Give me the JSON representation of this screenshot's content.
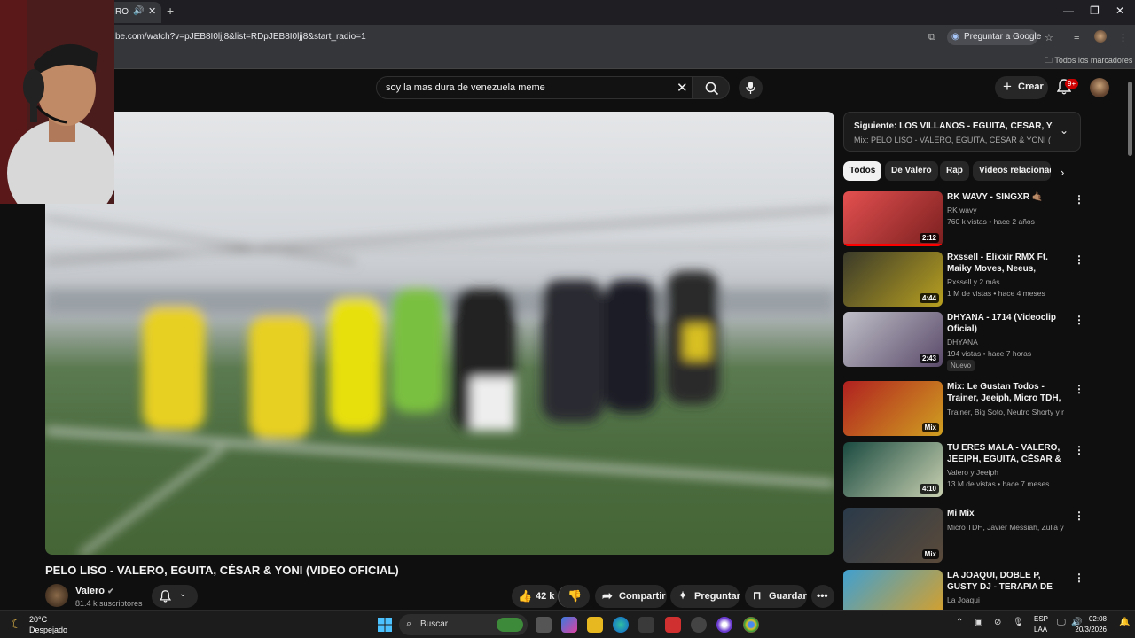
{
  "browser": {
    "tab_title": "RO",
    "url": "be.com/watch?v=pJEB8I0ljj8&list=RDpJEB8I0ljj8&start_radio=1",
    "ask_google": "Preguntar a Google",
    "all_bookmarks": "Todos los marcadores"
  },
  "youtube": {
    "search_query": "soy la mas dura de venezuela meme",
    "create_label": "Crear",
    "notification_count": "9+"
  },
  "video": {
    "title": "PELO LISO - VALERO, EGUITA, CÉSAR & YONI (VIDEO OFICIAL)",
    "channel": "Valero",
    "subscribers": "81.4 k suscriptores",
    "likes": "42 k",
    "share_label": "Compartir",
    "ask_label": "Preguntar",
    "save_label": "Guardar"
  },
  "up_next": {
    "title": "Siguiente: LOS VILLANOS - EGUITA, CESAR, YONI, V...",
    "subtitle": "Mix: PELO LISO - VALERO, EGUITA, CÉSAR & YONI (VIDEO OFIC"
  },
  "chips": [
    "Todos",
    "De Valero",
    "Rap",
    "Videos relacionados"
  ],
  "recommendations": [
    {
      "title": "RK WAVY - SINGXR 🤙🏽",
      "channel": "RK wavy",
      "meta": "760 k vistas • hace 2 años",
      "duration": "2:12",
      "progress": 1.0,
      "color1": "#e45050",
      "color2": "#7a1f1f"
    },
    {
      "title": "Rxssell - Elixxir RMX Ft. Maiky Moves, Neeus, SOYNEEL (Vide...",
      "channel": "Rxssell",
      "channel_extra": "y 2 más",
      "meta": "1 M de vistas • hace 4 meses",
      "duration": "4:44",
      "progress": 0.0,
      "color1": "#3a3a2a",
      "color2": "#b8a020"
    },
    {
      "title": "DHYANA - 1714 (Videoclip Oficial)",
      "channel": "DHYANA",
      "meta": "194 vistas • hace 7 horas",
      "badge": "Nuevo",
      "duration": "2:43",
      "progress": 0.0,
      "color1": "#c0c0c8",
      "color2": "#5a4a6a"
    },
    {
      "title": "Mix: Le Gustan Todos - Trainer, Jeeiph, Micro TDH, Big Soto, ...",
      "channel": "Trainer, Big Soto, Neutro Shorty y mucho...",
      "duration": "Mix",
      "progress": 0.0,
      "color1": "#b02020",
      "color2": "#d0a020"
    },
    {
      "title": "TU ERES MALA - VALERO, JEEIPH, EGUITA, CÉSAR & YO...",
      "channel": "Valero",
      "channel_extra": "y Jeeiph",
      "meta": "13 M de vistas • hace 7 meses",
      "duration": "4:10",
      "progress": 0.0,
      "color1": "#1a4a40",
      "color2": "#c8d0b0"
    },
    {
      "title": "Mi Mix",
      "channel": "Micro TDH, Javier Messiah, Zulla y much...",
      "duration": "Mix",
      "progress": 0.0,
      "color1": "#2a3a4a",
      "color2": "#5a4a3a"
    },
    {
      "title": "LA JOAQUI, DOBLE P, GUSTY DJ - TERAPIA DE CHOQUE (Video...",
      "channel": "La Joaqui",
      "duration": "",
      "progress": 0.0,
      "color1": "#40a0d0",
      "color2": "#e0a020"
    }
  ],
  "taskbar": {
    "temperature": "20°C",
    "weather": "Despejado",
    "search_placeholder": "Buscar",
    "lang1": "ESP",
    "lang2": "LAA",
    "time": "02:08",
    "date": "20/3/2026"
  },
  "colors": {
    "accent_red": "#ff0000",
    "badge_red": "#cc0000",
    "chrome_dark": "#35363a",
    "yt_bg": "#0f0f0f"
  }
}
